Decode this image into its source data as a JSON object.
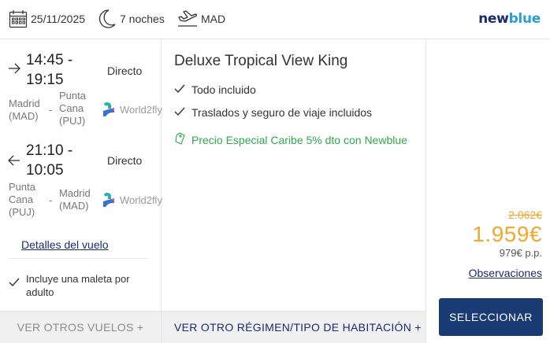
{
  "header": {
    "date": "25/11/2025",
    "nights": "7 noches",
    "origin": "MAD",
    "logo_part1": "new",
    "logo_part2": "blue"
  },
  "flights": [
    {
      "direction": "outbound",
      "depart": "14:45 -",
      "arrive": "19:15",
      "type": "Directo",
      "origin_city": "Madrid",
      "origin_code": "(MAD)",
      "dest_city1": "Punta",
      "dest_city2": "Cana",
      "dest_code": "(PUJ)",
      "airline": "World2fly"
    },
    {
      "direction": "return",
      "depart": "21:10 -",
      "arrive": "10:05",
      "type": "Directo",
      "origin_city1": "Punta",
      "origin_city2": "Cana",
      "origin_code": "(PUJ)",
      "dest_city": "Madrid",
      "dest_code": "(MAD)",
      "airline": "World2fly"
    }
  ],
  "flight_details_link": "Detalles del vuelo",
  "luggage": "Incluye una maleta por adulto",
  "footer_left": "VER OTROS VUELOS +",
  "room": {
    "title": "Deluxe Tropical View King",
    "features": [
      "Todo incluido",
      "Traslados y seguro de viaje incluidos"
    ],
    "promo": "Precio Especial Caribe 5% dto con Newblue"
  },
  "footer_mid": "VER OTRO RÉGIMEN/TIPO DE HABITACIÓN +",
  "pricing": {
    "old_price": "2.062€",
    "price": "1.959€",
    "per_person": "979€ p.p.",
    "observations": "Observaciones",
    "select_label": "SELECCIONAR"
  },
  "colors": {
    "brand_dark": "#1a2b6e",
    "brand_light": "#2a9fd6",
    "price": "#f0a830",
    "promo": "#2eaa4a",
    "button": "#1a3a74"
  }
}
